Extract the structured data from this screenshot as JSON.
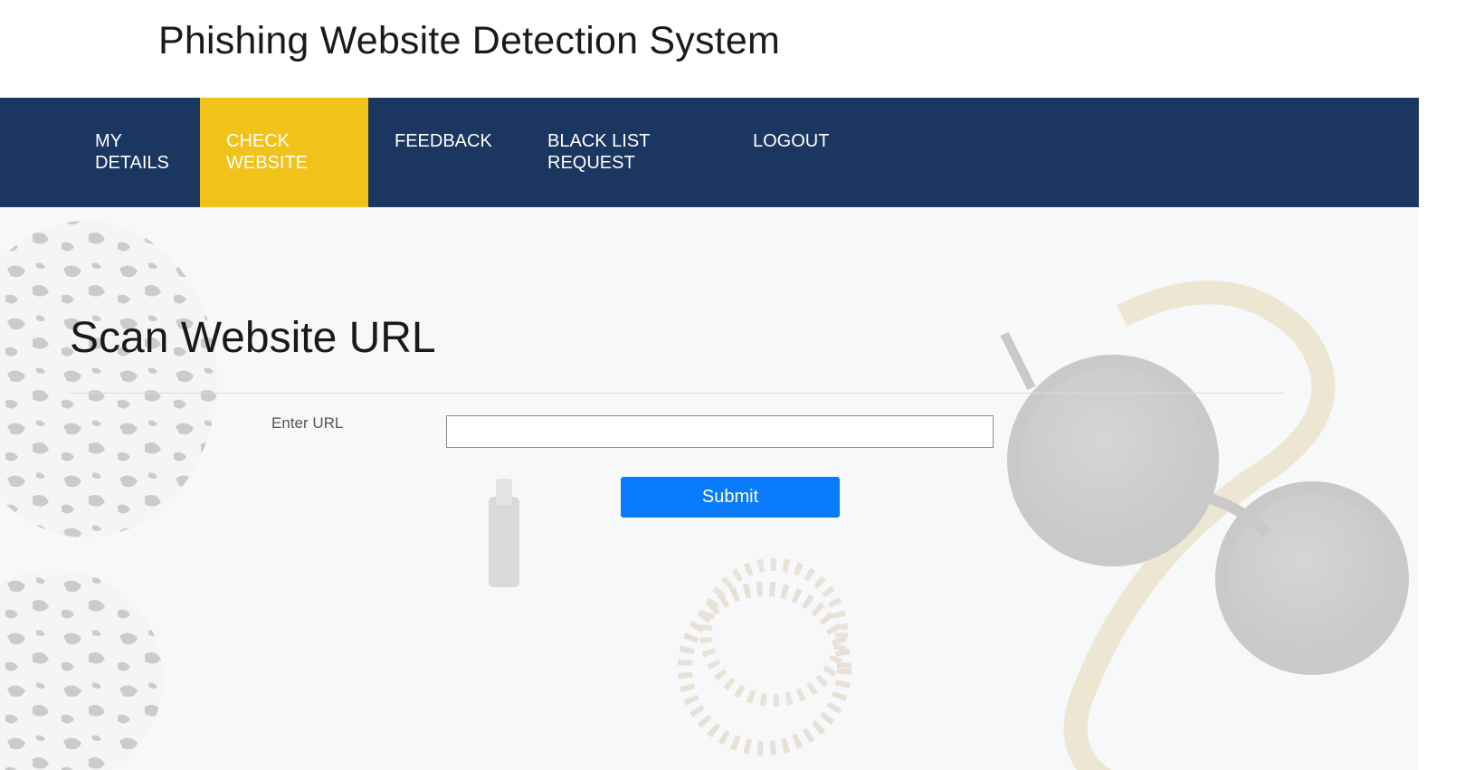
{
  "header": {
    "title": "Phishing Website Detection System"
  },
  "nav": {
    "items": [
      {
        "line1": "MY",
        "line2": "DETAILS"
      },
      {
        "line1": "CHECK",
        "line2": "WEBSITE",
        "active": true
      },
      {
        "line1": "FEEDBACK",
        "line2": ""
      },
      {
        "line1": "BLACK LIST",
        "line2": "REQUEST"
      },
      {
        "line1": "LOGOUT",
        "line2": ""
      }
    ]
  },
  "main": {
    "title": "Scan Website URL",
    "url_label": "Enter URL",
    "url_value": "",
    "submit_label": "Submit"
  },
  "colors": {
    "nav_background": "#1b3661",
    "nav_active": "#f1c21a",
    "submit_button": "#0a7cfb",
    "page_background": "#f2f4f6"
  },
  "background_image": "faded-flatlay-photo-leopard-pouch-sunglasses-wooden-bracelet"
}
